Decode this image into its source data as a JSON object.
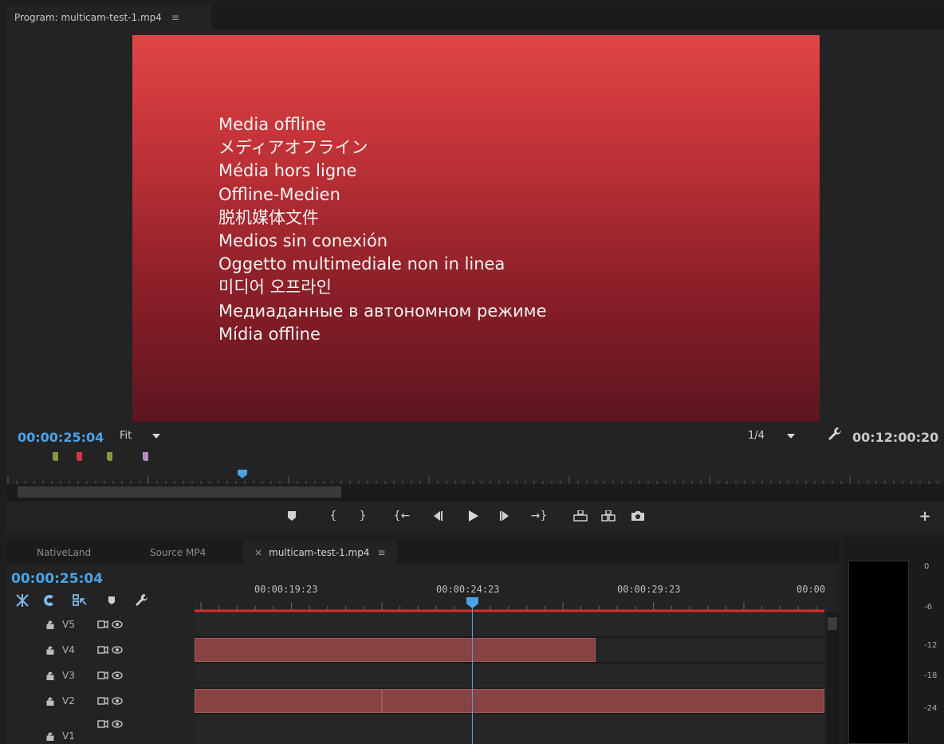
{
  "program_monitor": {
    "tab_title": "Program: multicam-test-1.mp4",
    "tab_menu_glyph": "≡",
    "offline_lines": [
      "Media offline",
      "メディアオフライン",
      "Média hors ligne",
      "Offline-Medien",
      "脱机媒体文件",
      "Medios sin conexión",
      "Oggetto multimediale non in linea",
      "미디어 오프라인",
      "Медиаданные в автономном режиме",
      "Mídia offline"
    ],
    "playhead_timecode": "00:00:25:04",
    "zoom_value": "Fit",
    "resolution_value": "1/4",
    "duration_timecode": "00:12:00:20",
    "marker_colors": [
      "#7f9a3c",
      "#d8324a",
      "#7f9a3c",
      "#b88ac2"
    ],
    "colors": {
      "accent": "#4aa3e8",
      "offline_top": "#e14546",
      "offline_bottom": "#5c1520"
    },
    "transport_icons": [
      "add-marker-icon",
      "mark-in-icon",
      "mark-out-icon",
      "go-to-in-icon",
      "step-back-icon",
      "play-icon",
      "step-forward-icon",
      "go-to-out-icon",
      "lift-icon",
      "extract-icon",
      "export-frame-icon"
    ],
    "add_button_glyph": "+"
  },
  "timeline": {
    "tabs": [
      "NativeLand",
      "Source MP4",
      "multicam-test-1.mp4"
    ],
    "active_tab_close": "×",
    "active_tab_menu": "≡",
    "playhead_timecode": "00:00:25:04",
    "ruler_labels": [
      "00:00:19:23",
      "00:00:24:23",
      "00:00:29:23",
      "00:00"
    ],
    "tracks": [
      {
        "name": "V5"
      },
      {
        "name": "V4"
      },
      {
        "name": "V3"
      },
      {
        "name": "V2"
      },
      {
        "name": "V1"
      }
    ],
    "clip_color": "#894242",
    "work_area_color": "#e02b2b"
  },
  "audio_meter": {
    "db_labels": [
      "0",
      "-6",
      "-12",
      "-18",
      "-24"
    ]
  }
}
